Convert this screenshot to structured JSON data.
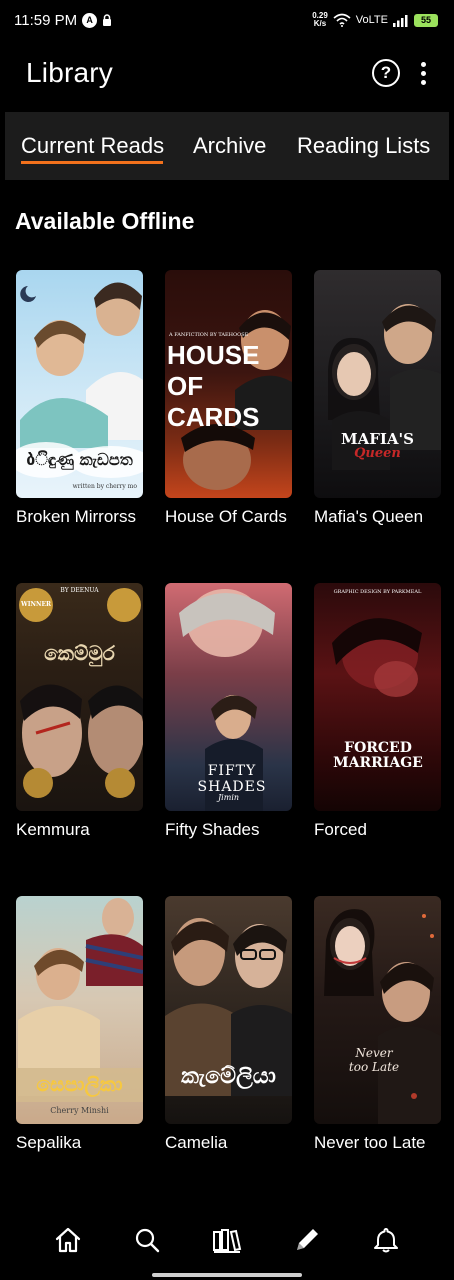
{
  "status_bar": {
    "time": "11:59 PM",
    "a_badge": "A",
    "net_speed_value": "0.29",
    "net_speed_unit": "K/s",
    "network": "VoLTE",
    "battery": "55"
  },
  "header": {
    "title": "Library"
  },
  "tabs": [
    {
      "label": "Current Reads",
      "active": true
    },
    {
      "label": "Archive",
      "active": false
    },
    {
      "label": "Reading Lists",
      "active": false
    }
  ],
  "section": {
    "title": "Available Offline"
  },
  "books": [
    {
      "title": "Broken Mirrorss",
      "cover_caption": "ბිඳුණු කැඩපත",
      "cover_credit": "written by cherry mo"
    },
    {
      "title": "House Of Cards",
      "cover_caption": "HOUSE OF CARDS",
      "cover_credit": "A FANFICTION BY TAEHOOSE"
    },
    {
      "title": "Mafia's Queen",
      "cover_caption": "MAFIA'S",
      "cover_caption2": "Queen"
    },
    {
      "title": "Kemmura",
      "cover_caption": "කෙම්මුර",
      "cover_badge": "WINNER",
      "cover_credit": "BY DEENUA"
    },
    {
      "title": "Fifty Shades",
      "cover_caption": "FIFTY SHADES",
      "cover_caption2": "Jimin"
    },
    {
      "title": "Forced",
      "cover_caption": "FORCED MARRIAGE",
      "cover_credit": "GRAPHIC DESIGN BY PARKMEAL"
    },
    {
      "title": "Sepalika",
      "cover_caption": "සෙපාලිකා",
      "cover_credit": "Cherry Minshi"
    },
    {
      "title": "Camelia",
      "cover_caption": "කැමේලියා"
    },
    {
      "title": "Never too Late",
      "cover_caption": "Never too Late"
    }
  ],
  "colors": {
    "accent": "#f2711c",
    "background": "#000000",
    "tab_bar": "#1c1c1c",
    "battery": "#9be15d"
  },
  "nav": [
    {
      "icon": "home-icon"
    },
    {
      "icon": "search-icon"
    },
    {
      "icon": "library-icon"
    },
    {
      "icon": "pencil-icon"
    },
    {
      "icon": "bell-icon"
    }
  ]
}
